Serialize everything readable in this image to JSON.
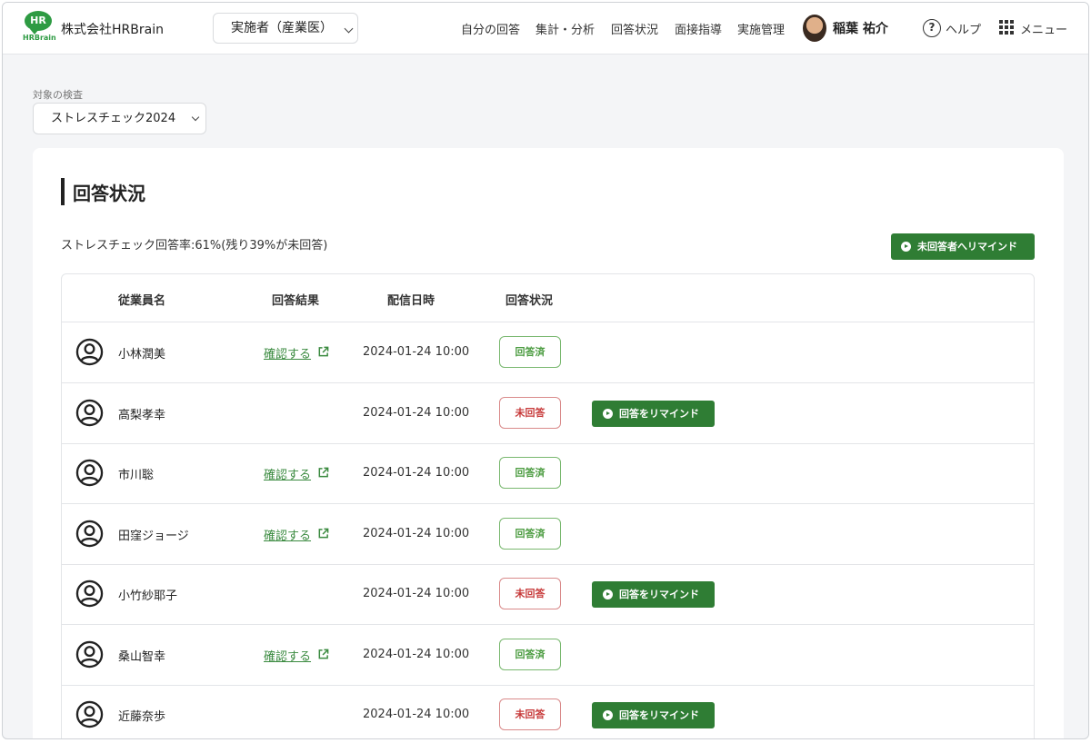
{
  "header": {
    "logo_text": "HR",
    "logo_sub": "HRBrain",
    "company": "株式会社HRBrain",
    "role_select": "実施者（産業医）",
    "nav": [
      "自分の回答",
      "集計・分析",
      "回答状況",
      "面接指導",
      "実施管理"
    ],
    "user_name": "稲葉 祐介",
    "help_label": "ヘルプ",
    "menu_label": "メニュー"
  },
  "filter": {
    "label": "対象の検査",
    "value": "ストレスチェック2024"
  },
  "main": {
    "title": "回答状況",
    "rate_text": "ストレスチェック回答率:61%(残り39%が未回答)",
    "remind_all_label": "未回答者へリマインド"
  },
  "table": {
    "headers": [
      "従業員名",
      "回答結果",
      "配信日時",
      "回答状況"
    ],
    "confirm_label": "確認する",
    "remind_label": "回答をリマインド",
    "rows": [
      {
        "name": "小林潤美",
        "date": "2024-01-24 10:00",
        "status": "回答済",
        "answered": true
      },
      {
        "name": "高梨孝幸",
        "date": "2024-01-24 10:00",
        "status": "未回答",
        "answered": false
      },
      {
        "name": "市川聡",
        "date": "2024-01-24 10:00",
        "status": "回答済",
        "answered": true
      },
      {
        "name": "田窪ジョージ",
        "date": "2024-01-24 10:00",
        "status": "回答済",
        "answered": true
      },
      {
        "name": "小竹紗耶子",
        "date": "2024-01-24 10:00",
        "status": "未回答",
        "answered": false
      },
      {
        "name": "桑山智幸",
        "date": "2024-01-24 10:00",
        "status": "回答済",
        "answered": true
      },
      {
        "name": "近藤奈歩",
        "date": "2024-01-24 10:00",
        "status": "未回答",
        "answered": false
      }
    ]
  },
  "colors": {
    "brand_green": "#2e9b43",
    "button_green": "#2f7d34",
    "answered": "#4a9b3f",
    "unanswered": "#c73a3a"
  }
}
